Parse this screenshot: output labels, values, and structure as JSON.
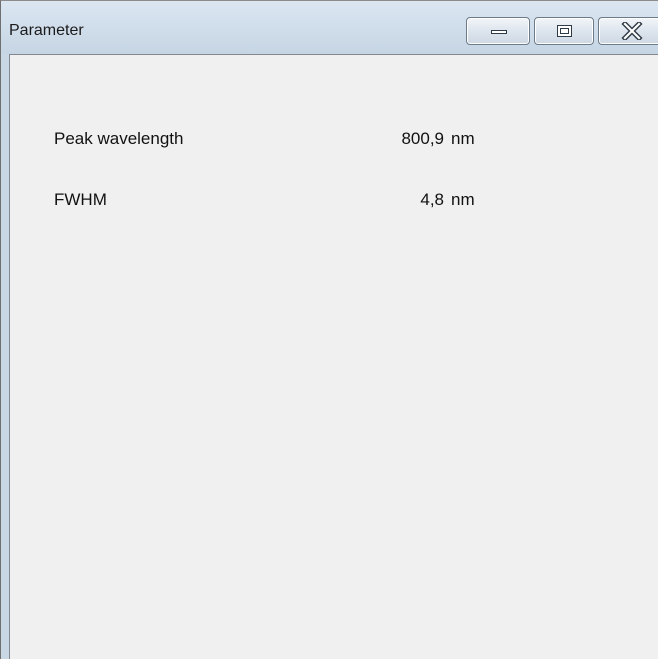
{
  "window": {
    "title": "Parameter"
  },
  "controls": {
    "minimize_icon": "minimize-icon",
    "maximize_icon": "maximize-icon",
    "close_icon": "close-icon"
  },
  "parameters": [
    {
      "label": "Peak wavelength",
      "value": "800,9",
      "unit": "nm"
    },
    {
      "label": "FWHM",
      "value": "4,8",
      "unit": "nm"
    }
  ],
  "colors": {
    "titlebar": "#c9d6e3",
    "client_background": "#f0f0f0"
  }
}
